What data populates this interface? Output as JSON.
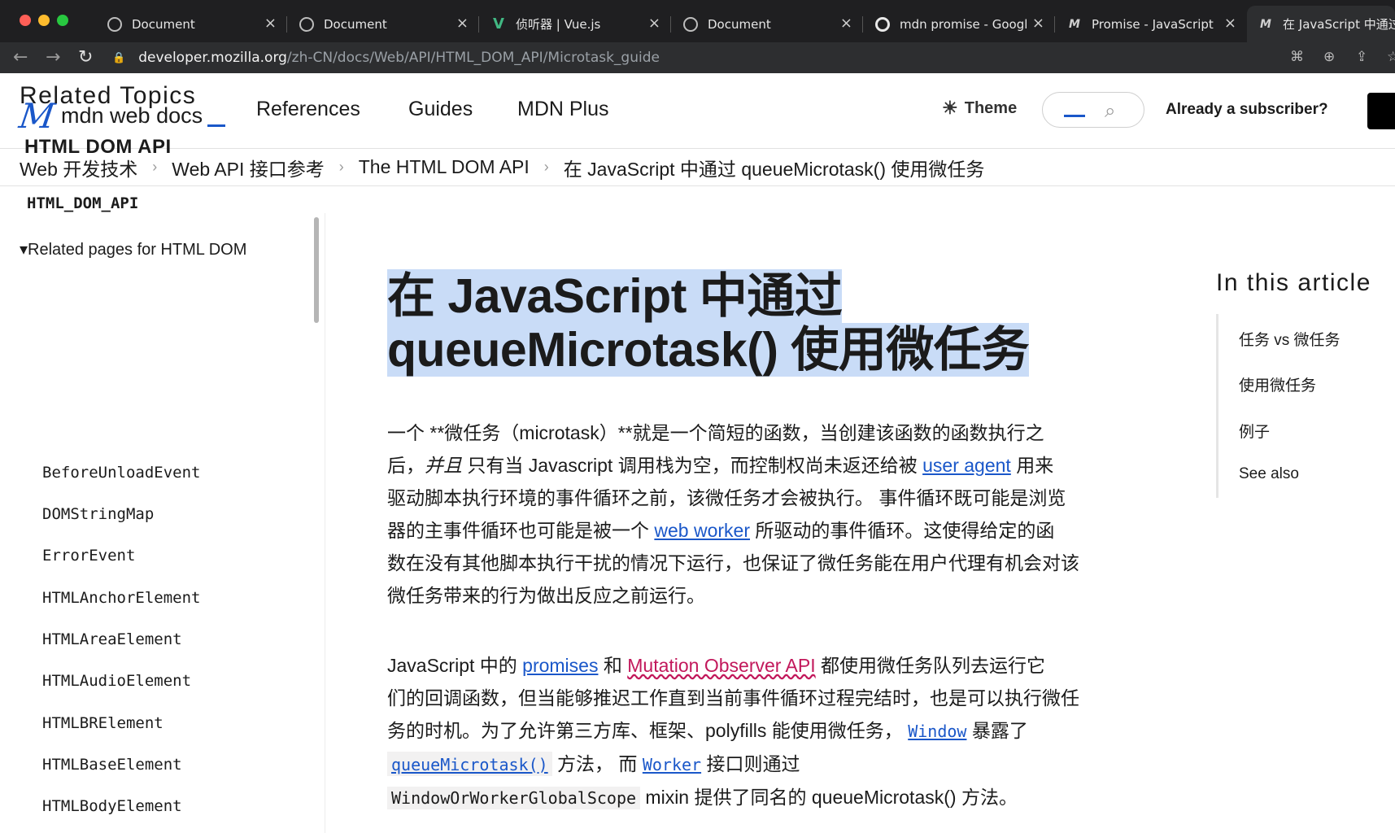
{
  "browser": {
    "tabs": [
      {
        "title": "Document",
        "icon": "globe-icon"
      },
      {
        "title": "Document",
        "icon": "globe-icon"
      },
      {
        "title": "侦听器 | Vue.js",
        "icon": "vue-icon"
      },
      {
        "title": "Document",
        "icon": "globe-icon"
      },
      {
        "title": "mdn promise - Googl",
        "icon": "google-icon"
      },
      {
        "title": "Promise - JavaScript",
        "icon": "mdn-icon"
      },
      {
        "title": "在 JavaScript 中通过",
        "icon": "mdn-icon"
      }
    ],
    "url_host": "developer.mozilla.org",
    "url_path": "/zh-CN/docs/Web/API/HTML_DOM_API/Microtask_guide",
    "colors": {
      "chrome_bg": "#1f1f21",
      "toolbar_bg": "#2d2e30"
    }
  },
  "header": {
    "logo_mark": "M",
    "logo_text": "mdn web docs",
    "nav": [
      "References",
      "Guides",
      "MDN Plus"
    ],
    "theme_label": "Theme",
    "subscriber_label": "Already a subscriber?"
  },
  "breadcrumb": [
    "Web 开发技术",
    "Web API 接口参考",
    "The HTML DOM API",
    "在 JavaScript 中通过 queueMicrotask() 使用微任务"
  ],
  "sidebar": {
    "title": "Related Topics",
    "heading": "HTML DOM API",
    "subheading": "HTML_DOM_API",
    "details_label": "Related pages for HTML DOM",
    "items": [
      "BeforeUnloadEvent",
      "DOMStringMap",
      "ErrorEvent",
      "HTMLAnchorElement",
      "HTMLAreaElement",
      "HTMLAudioElement",
      "HTMLBRElement",
      "HTMLBaseElement",
      "HTMLBodyElement"
    ]
  },
  "article": {
    "title_line1": "在 JavaScript 中通过",
    "title_line2": "queueMicrotask() 使用微任务",
    "p1": {
      "l1": "一个 **微任务（microtask）**就是一个简短的函数，当创建该函数的函数执行之",
      "l2a": "后，",
      "l2b": "并且",
      "l2c": " 只有当 Javascript 调用栈为空，而控制权尚未返还给被 ",
      "l2link": "user agent",
      "l2d": " 用来",
      "l3": "驱动脚本执行环境的事件循环之前，该微任务才会被执行。 事件循环既可能是浏览",
      "l4a": "器的主事件循环也可能是被一个 ",
      "l4link": "web worker",
      "l4b": " 所驱动的事件循环。这使得给定的函",
      "l5": "数在没有其他脚本执行干扰的情况下运行，也保证了微任务能在用户代理有机会对该",
      "l6": "微任务带来的行为做出反应之前运行。"
    },
    "p2": {
      "l1a": "JavaScript 中的 ",
      "l1link1": "promises",
      "l1b": " 和 ",
      "l1link2": "Mutation Observer API",
      "l1c": " 都使用微任务队列去运行它",
      "l2": "们的回调函数，但当能够推迟工作直到当前事件循环过程完结时，也是可以执行微任",
      "l3a": "务的时机。为了允许第三方库、框架、polyfills 能使用微任务， ",
      "l3link": "Window",
      "l3b": " 暴露了",
      "l4link1": "queueMicrotask()",
      "l4a": " 方法， 而 ",
      "l4link2": "Worker",
      "l4b": " 接口则通过",
      "l5code": "WindowOrWorkerGlobalScope",
      "l5a": " mixin 提供了同名的 queueMicrotask() 方法。"
    }
  },
  "toc": {
    "title": "In this article",
    "items": [
      "任务 vs 微任务",
      "使用微任务",
      "例子",
      "See also"
    ]
  },
  "colors": {
    "link": "#1a57c9",
    "highlight": "#c9dcf7",
    "flagged_link": "#c2185b"
  }
}
